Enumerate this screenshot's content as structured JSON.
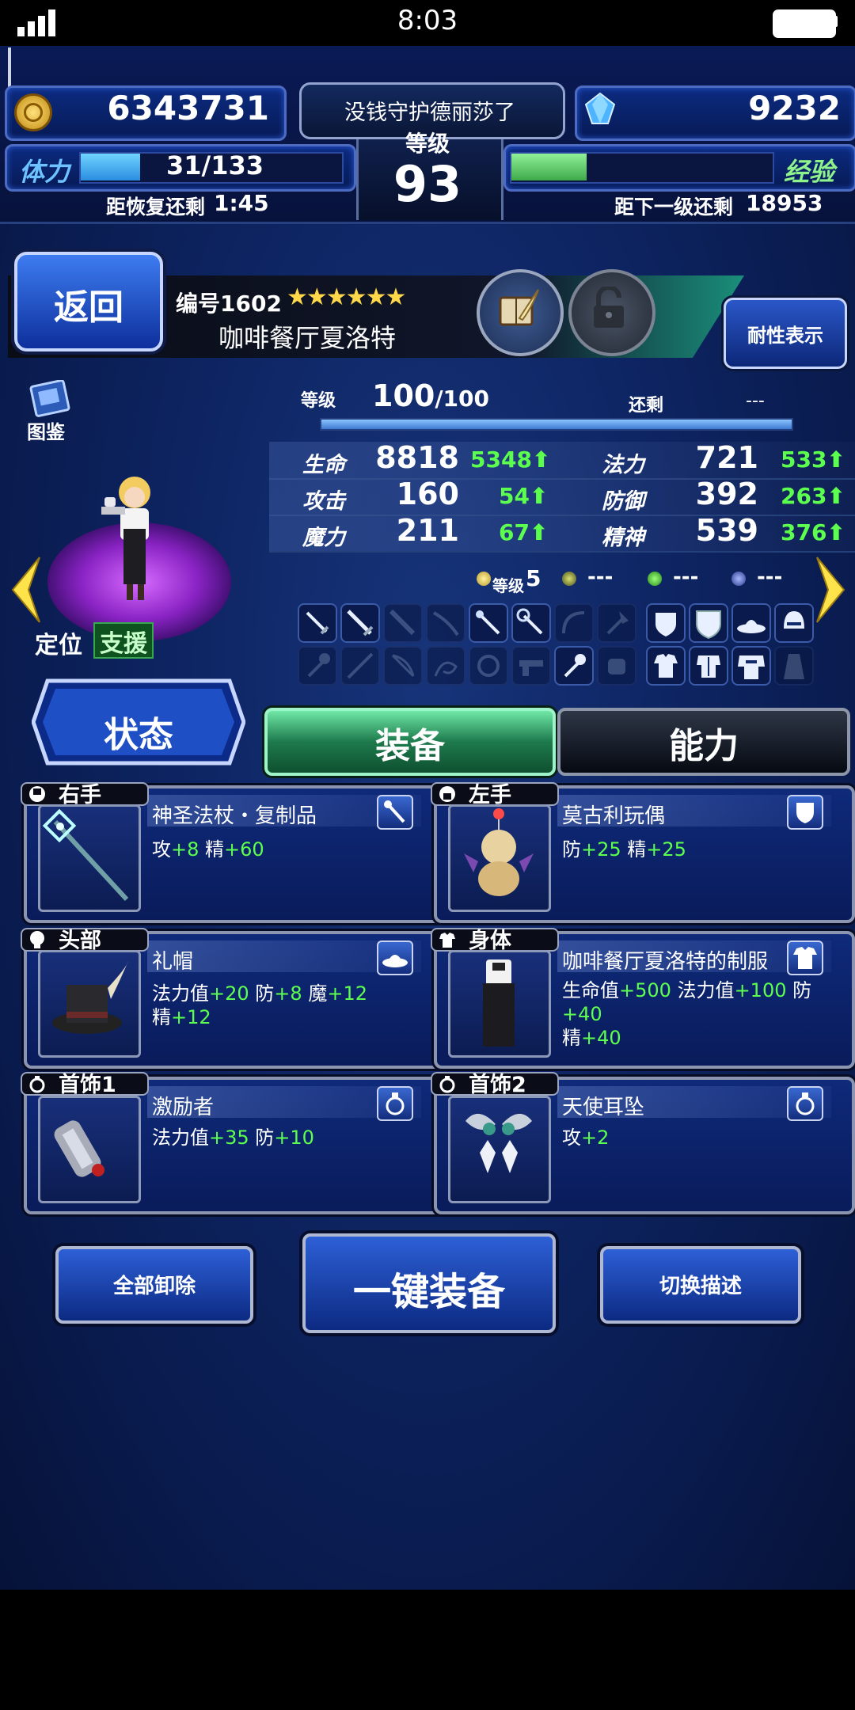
{
  "status_bar": {
    "time": "8:03"
  },
  "header": {
    "coins": "6343731",
    "gems": "9232",
    "player_title": "没钱守护德丽莎了",
    "level_label": "等级",
    "level": "93",
    "stamina_label": "体力",
    "stamina_value": "31/133",
    "stamina_ratio": 0.23,
    "recover_label": "距恢复还剩",
    "recover_time": "1:45",
    "exp_label": "经验",
    "exp_ratio": 0.29,
    "next_label": "距下一级还剩",
    "next_value": "18953"
  },
  "character": {
    "back_label": "返回",
    "number": "编号1602",
    "stars": "★★★★★★",
    "name": "咖啡餐厅夏洛特",
    "resistance_label": "耐性表示",
    "codex_label": "图鉴",
    "position_label": "定位",
    "role": "支援",
    "level_label": "等级",
    "level_current": "100",
    "level_max": "/100",
    "remaining_label": "还剩",
    "remaining_value": "---",
    "stats": [
      {
        "label": "生命",
        "value": "8818",
        "bonus": "5348",
        "label2": "法力",
        "value2": "721",
        "bonus2": "533"
      },
      {
        "label": "攻击",
        "value": "160",
        "bonus": "54",
        "label2": "防御",
        "value2": "392",
        "bonus2": "263"
      },
      {
        "label": "魔力",
        "value": "211",
        "bonus": "67",
        "label2": "精神",
        "value2": "539",
        "bonus2": "376"
      }
    ],
    "crystal_level_label": "等级",
    "crystal_level": "5",
    "crystal_2": "---",
    "crystal_3": "---",
    "crystal_4": "---"
  },
  "tabs": {
    "status": "状态",
    "equip": "装备",
    "ability": "能力"
  },
  "slots": [
    {
      "tag": "右手",
      "name": "神圣法杖・复制品",
      "stats": [
        [
          "攻",
          "+8"
        ],
        [
          "精",
          "+60"
        ]
      ],
      "stats2": []
    },
    {
      "tag": "左手",
      "name": "莫古利玩偶",
      "stats": [
        [
          "防",
          "+25"
        ],
        [
          "精",
          "+25"
        ]
      ],
      "stats2": []
    },
    {
      "tag": "头部",
      "name": "礼帽",
      "stats": [
        [
          "法力值",
          "+20"
        ],
        [
          "防",
          "+8"
        ],
        [
          "魔",
          "+12"
        ]
      ],
      "stats2": [
        [
          "精",
          "+12"
        ]
      ]
    },
    {
      "tag": "身体",
      "name": "咖啡餐厅夏洛特的制服",
      "stats": [
        [
          "生命值",
          "+500"
        ],
        [
          "法力值",
          "+100"
        ],
        [
          "防",
          "+40"
        ]
      ],
      "stats2": [
        [
          "精",
          "+40"
        ]
      ]
    },
    {
      "tag": "首饰1",
      "name": "激励者",
      "stats": [
        [
          "法力值",
          "+35"
        ],
        [
          "防",
          "+10"
        ]
      ],
      "stats2": []
    },
    {
      "tag": "首饰2",
      "name": "天使耳坠",
      "stats": [
        [
          "攻",
          "+2"
        ]
      ],
      "stats2": []
    }
  ],
  "buttons": {
    "remove_all": "全部卸除",
    "auto_equip": "一键装备",
    "switch_desc": "切换描述"
  },
  "colors": {
    "bonus_green": "#5dff4e",
    "panel_blue": "#0c2b80",
    "equip_tab": "#1d7a4c"
  }
}
